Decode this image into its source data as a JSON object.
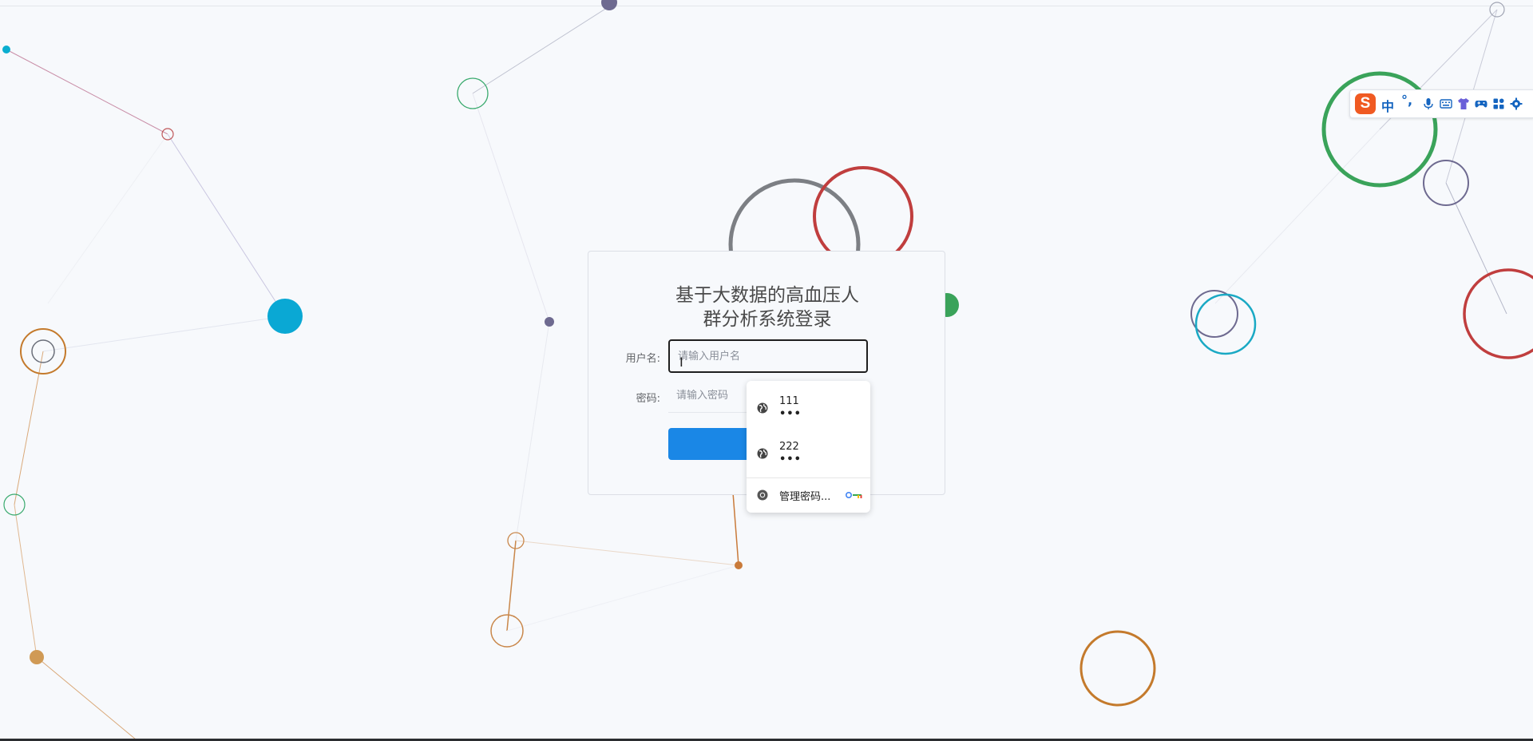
{
  "login": {
    "title_line1": "基于大数据的高血压人",
    "title_line2": "群分析系统登录",
    "username_label": "用户名:",
    "username_placeholder": "请输入用户名",
    "password_label": "密码:",
    "password_placeholder": "请输入密码",
    "login_button_label": ""
  },
  "autofill": {
    "entries": [
      {
        "username": "111",
        "password_mask": "•••",
        "icon": "globe-icon"
      },
      {
        "username": "222",
        "password_mask": "•••",
        "icon": "globe-icon"
      }
    ],
    "manage_label": "管理密码...",
    "manage_icon": "chrome-icon",
    "key_icon": "google-password-manager-icon"
  },
  "ime_toolbar": {
    "logo": "S",
    "lang": "中",
    "punct": "°,",
    "icons": [
      "microphone-icon",
      "keyboard-icon",
      "skin-shirt-icon",
      "gamepad-icon",
      "toolbox-grid-icon",
      "settings-icon"
    ]
  },
  "colors": {
    "primary": "#1a87e6",
    "background": "#f7f9fc",
    "ime_logo": "#f05a22",
    "ime_accent": "#1565c0"
  }
}
